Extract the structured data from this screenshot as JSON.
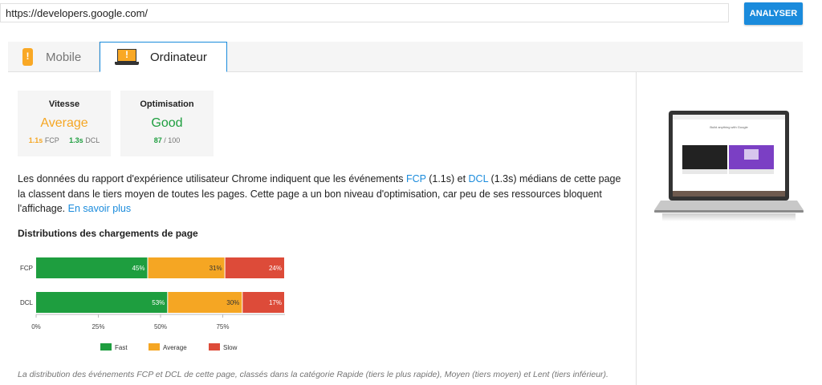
{
  "url_bar": {
    "value": "https://developers.google.com/",
    "analyze_label": "ANALYSER"
  },
  "tabs": {
    "mobile": "Mobile",
    "desktop": "Ordinateur"
  },
  "cards": {
    "speed": {
      "title": "Vitesse",
      "value": "Average",
      "fcp_value": "1.1s",
      "fcp_label": "FCP",
      "dcl_value": "1.3s",
      "dcl_label": "DCL"
    },
    "optimization": {
      "title": "Optimisation",
      "value": "Good",
      "score": "87",
      "score_total": "/ 100"
    }
  },
  "description": {
    "p1": "Les données du rapport d'expérience utilisateur Chrome indiquent que les événements ",
    "fcp_link": "FCP",
    "p2": " (1.1s) et ",
    "dcl_link": "DCL",
    "p3": " (1.3s) médians de cette page la classent dans le tiers moyen de toutes les pages. Cette page a un bon niveau d'optimisation, car peu de ses ressources bloquent l'affichage. ",
    "more_link": "En savoir plus"
  },
  "distribution": {
    "title": "Distributions des chargements de page"
  },
  "chart_data": {
    "type": "bar",
    "orientation": "horizontal",
    "stacked": true,
    "categories": [
      "FCP",
      "DCL"
    ],
    "series": [
      {
        "name": "Fast",
        "values": [
          45,
          53
        ],
        "color": "#1e9e3f"
      },
      {
        "name": "Average",
        "values": [
          31,
          30
        ],
        "color": "#f5a623"
      },
      {
        "name": "Slow",
        "values": [
          24,
          17
        ],
        "color": "#dd4b39"
      }
    ],
    "x_ticks": [
      "0%",
      "25%",
      "50%",
      "75%"
    ],
    "xlim": [
      0,
      100
    ],
    "legend_position": "bottom"
  },
  "caption": "La distribution des événements FCP et DCL de cette page, classés dans la catégorie Rapide (tiers le plus rapide), Moyen (tiers moyen) et Lent (tiers inférieur).",
  "thumbnail": {
    "site_headline": "Build anything with Google"
  }
}
